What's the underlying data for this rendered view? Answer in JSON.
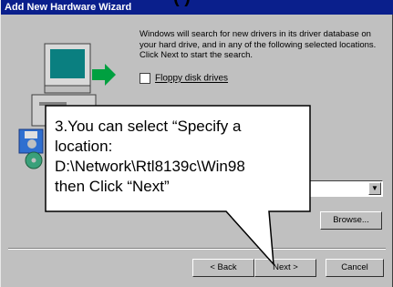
{
  "window": {
    "title": "Add New Hardware Wizard"
  },
  "header": {
    "paren": "( )"
  },
  "intro_text": "Windows will search for new drivers in its driver database on your hard drive, and in any of the following selected locations. Click Next to start the search.",
  "options": {
    "floppy_label": "Floppy disk drives",
    "floppy_checked": false
  },
  "callout": {
    "lines": "3.You can select “Specify a\nlocation:\nD:\\Network\\Rtl8139c\\Win98\nthen Click “Next”"
  },
  "buttons": {
    "browse": "Browse...",
    "back": "< Back",
    "next": "Next >",
    "cancel": "Cancel"
  },
  "colors": {
    "titlebar": "#0a1f8c",
    "face": "#c0c0c0"
  }
}
